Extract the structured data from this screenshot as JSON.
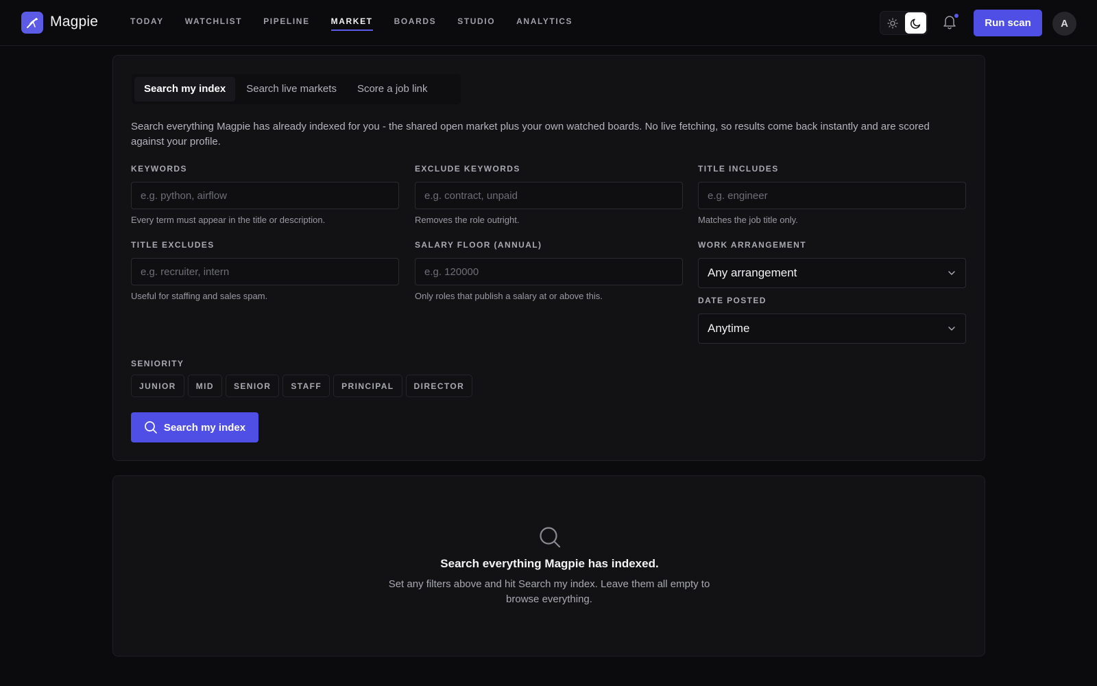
{
  "app": {
    "name": "Magpie"
  },
  "nav": {
    "items": [
      {
        "label": "TODAY",
        "active": false
      },
      {
        "label": "WATCHLIST",
        "active": false
      },
      {
        "label": "PIPELINE",
        "active": false
      },
      {
        "label": "MARKET",
        "active": true
      },
      {
        "label": "BOARDS",
        "active": false
      },
      {
        "label": "STUDIO",
        "active": false
      },
      {
        "label": "ANALYTICS",
        "active": false
      }
    ]
  },
  "header": {
    "theme": "dark",
    "run_scan_label": "Run scan",
    "avatar_initial": "A",
    "notification_indicator": true
  },
  "colors": {
    "accent": "#4f4fe6",
    "background": "#0b0b0d",
    "card": "#121215"
  },
  "search": {
    "tabs": [
      {
        "label": "Search my index",
        "active": true
      },
      {
        "label": "Search live markets",
        "active": false
      },
      {
        "label": "Score a job link",
        "active": false
      }
    ],
    "intro": "Search everything Magpie has already indexed for you - the shared open market plus your own watched boards. No live fetching, so results come back instantly and are scored against your profile.",
    "fields": {
      "keywords": {
        "label": "KEYWORDS",
        "placeholder": "e.g. python, airflow",
        "value": "",
        "help": "Every term must appear in the title or description."
      },
      "exclude_keywords": {
        "label": "EXCLUDE KEYWORDS",
        "placeholder": "e.g. contract, unpaid",
        "value": "",
        "help": "Removes the role outright."
      },
      "title_includes": {
        "label": "TITLE INCLUDES",
        "placeholder": "e.g. engineer",
        "value": "",
        "help": "Matches the job title only."
      },
      "title_excludes": {
        "label": "TITLE EXCLUDES",
        "placeholder": "e.g. recruiter, intern",
        "value": "",
        "help": "Useful for staffing and sales spam."
      },
      "salary_floor": {
        "label": "SALARY FLOOR (ANNUAL)",
        "placeholder": "e.g. 120000",
        "value": "",
        "help": "Only roles that publish a salary at or above this."
      },
      "work_arrangement": {
        "label": "WORK ARRANGEMENT",
        "value": "Any arrangement"
      },
      "date_posted": {
        "label": "DATE POSTED",
        "value": "Anytime"
      }
    },
    "seniority": {
      "label": "SENIORITY",
      "options": [
        "JUNIOR",
        "MID",
        "SENIOR",
        "STAFF",
        "PRINCIPAL",
        "DIRECTOR"
      ]
    },
    "submit_label": "Search my index"
  },
  "empty_state": {
    "title": "Search everything Magpie has indexed.",
    "text": "Set any filters above and hit Search my index. Leave them all empty to browse everything."
  }
}
